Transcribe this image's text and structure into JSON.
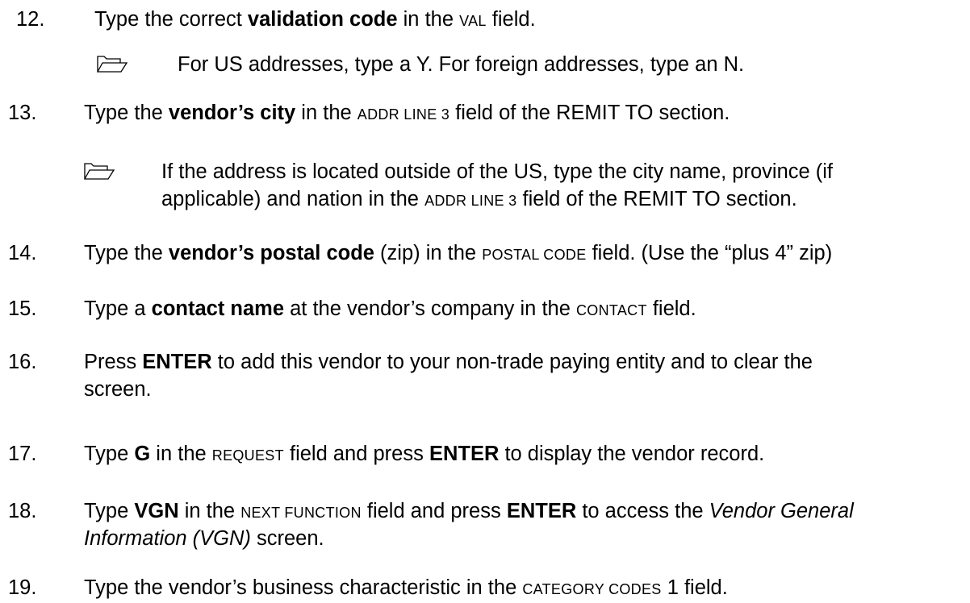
{
  "steps": [
    {
      "number": "12.",
      "parts": [
        "Type the correct ",
        "validation code",
        " in the ",
        "VAL",
        " field."
      ]
    },
    {
      "number": "13.",
      "parts": [
        "Type the ",
        "vendor’s city",
        " in the ",
        "ADDR LINE 3",
        " field of the REMIT TO section."
      ]
    },
    {
      "number": "14.",
      "parts": [
        "Type the ",
        "vendor’s postal code",
        " (zip) in the ",
        "POSTAL CODE",
        " field. (Use the “plus 4” zip)"
      ]
    },
    {
      "number": "15.",
      "parts": [
        "Type a ",
        "contact name",
        " at the vendor’s company in the ",
        "CONTACT",
        " field."
      ]
    },
    {
      "number": "16.",
      "parts": [
        "Press ",
        "ENTER",
        " to add this vendor to your non-trade paying entity and to clear the",
        "screen."
      ]
    },
    {
      "number": "17.",
      "parts": [
        "Type ",
        "G",
        " in the ",
        "REQUEST",
        " field and press ",
        "ENTER",
        " to display the vendor record."
      ]
    },
    {
      "number": "18.",
      "parts": [
        "Type ",
        "VGN",
        " in the ",
        "NEXT FUNCTION",
        " field and press ",
        "ENTER",
        " to access the ",
        "Vendor General",
        "Information (VGN)",
        " screen."
      ]
    },
    {
      "number": "19.",
      "parts": [
        "Type the vendor’s business characteristic in the ",
        "CATEGORY CODES",
        " 1 field."
      ]
    }
  ],
  "notes": {
    "note_12": "For US addresses, type a Y. For foreign addresses, type an N.",
    "note_13_line1": "If the address is located outside of the US, type the city name, province (if",
    "note_13_line2_a": "applicable) and nation in the ",
    "note_13_line2_b": "ADDR LINE 3",
    "note_13_line2_c": " field of the REMIT TO section."
  },
  "icons": {
    "note": "open-folder-icon"
  }
}
